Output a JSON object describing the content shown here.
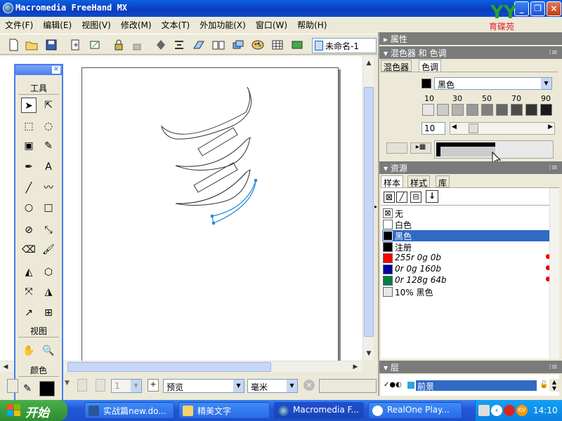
{
  "window": {
    "title": "Macromedia FreeHand MX"
  },
  "logo": {
    "text": "育碟苑",
    "letters": "YY"
  },
  "menu": [
    "文件(F)",
    "编辑(E)",
    "视图(V)",
    "修改(M)",
    "文本(T)",
    "外加功能(X)",
    "窗口(W)",
    "帮助(H)"
  ],
  "toolbar": {
    "document_selector": "未命名-1"
  },
  "tools_panel": {
    "section_tools": "工具",
    "section_view": "视图",
    "section_color": "颜色"
  },
  "status": {
    "view_mode": "预览",
    "units": "毫米",
    "page_number": "1"
  },
  "panels": {
    "properties": {
      "title": "属性"
    },
    "mixer": {
      "title": "混色器 和 色调",
      "tabs": [
        "混色器",
        "色调"
      ],
      "active_tab": "色调",
      "color_name": "黑色",
      "ticks": [
        "10",
        "30",
        "50",
        "70",
        "90"
      ],
      "tint_value": "10",
      "colors": {
        "black": "#000000"
      }
    },
    "assets": {
      "title": "资源",
      "tabs": [
        "样本",
        "样式",
        "库"
      ],
      "active_tab": "样本",
      "swatches": [
        {
          "name": "无",
          "color": "none"
        },
        {
          "name": "白色",
          "color": "#ffffff"
        },
        {
          "name": "黑色",
          "color": "#000000",
          "selected": true
        },
        {
          "name": "注册",
          "color": "#000000"
        },
        {
          "name": "255r 0g 0b",
          "color": "#ff0000",
          "italic": true
        },
        {
          "name": "0r 0g 160b",
          "color": "#0000a0",
          "italic": true
        },
        {
          "name": "0r 128g 64b",
          "color": "#008040",
          "italic": true
        },
        {
          "name": "10% 黑色",
          "color": "#e6e6e6"
        }
      ]
    },
    "layers": {
      "title": "层",
      "layer_name": "前景"
    }
  },
  "taskbar": {
    "start_label": "开始",
    "tasks": [
      "实战篇new.do...",
      "精美文字",
      "Macromedia F...",
      "RealOne Play..."
    ],
    "clock": "14:10"
  }
}
